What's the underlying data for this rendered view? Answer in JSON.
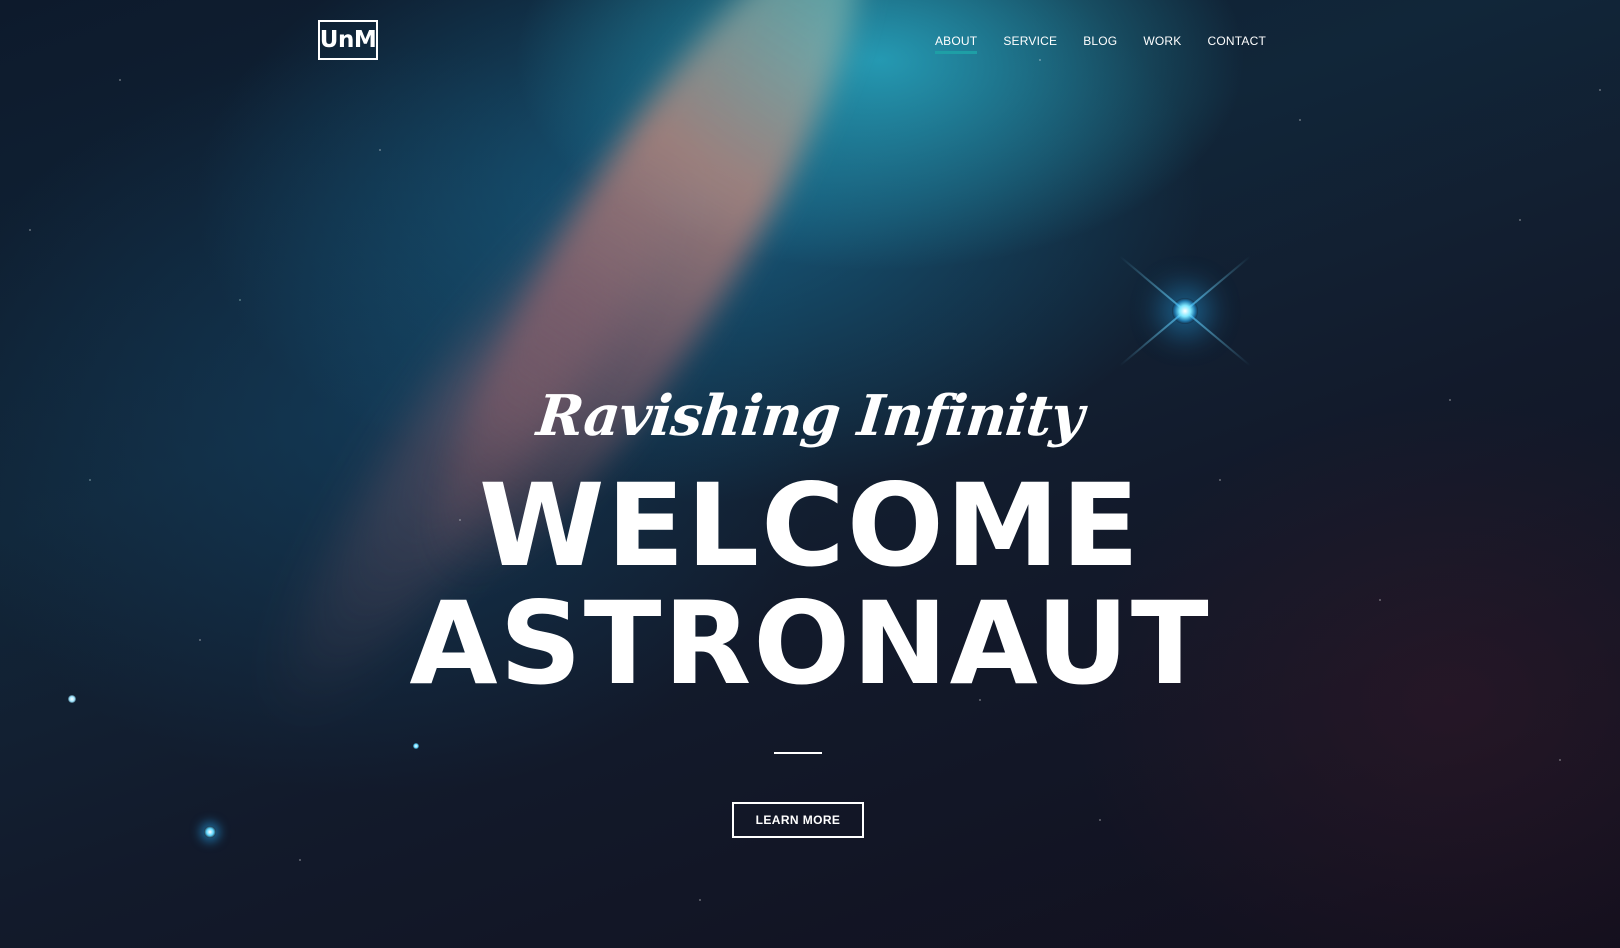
{
  "brand": {
    "logo_text": "UnM"
  },
  "nav": {
    "items": [
      {
        "label": "ABOUT",
        "active": true
      },
      {
        "label": "SERVICE",
        "active": false
      },
      {
        "label": "BLOG",
        "active": false
      },
      {
        "label": "WORK",
        "active": false
      },
      {
        "label": "CONTACT",
        "active": false
      }
    ],
    "active_color": "#1e9fa6"
  },
  "hero": {
    "tagline": "Ravishing Infinity",
    "headline_line1": "WELCOME",
    "headline_line2": "ASTRONAUT",
    "cta_label": "LEARN MORE",
    "background_icon": "space-nebula-background"
  }
}
